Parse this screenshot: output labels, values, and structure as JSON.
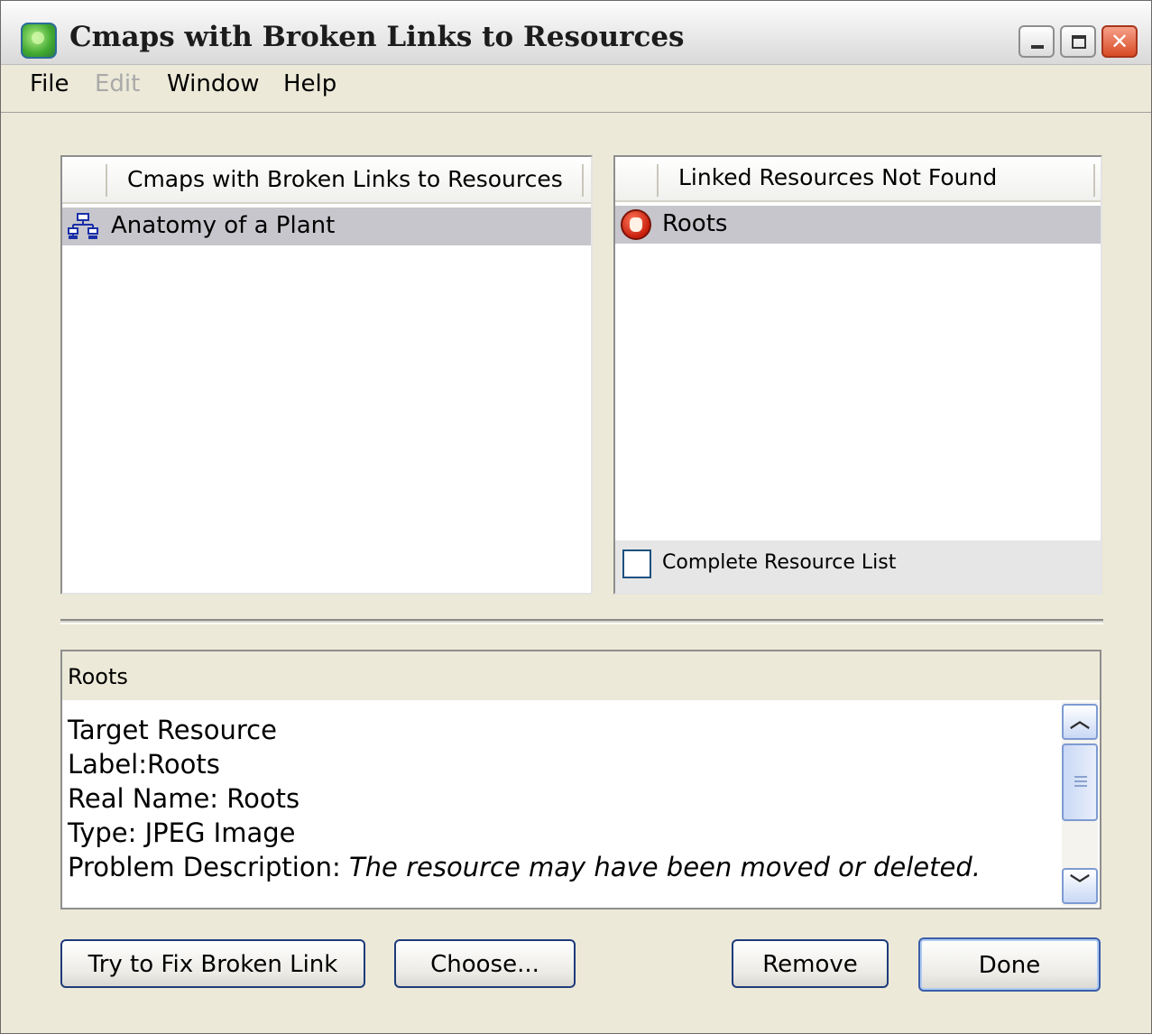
{
  "window": {
    "title": "Cmaps with Broken Links to Resources"
  },
  "menu": {
    "items": [
      {
        "label": "File",
        "enabled": true
      },
      {
        "label": "Edit",
        "enabled": false
      },
      {
        "label": "Window",
        "enabled": true
      },
      {
        "label": "Help",
        "enabled": true
      }
    ]
  },
  "cmaps_list": {
    "header": "Cmaps with Broken Links to Resources",
    "rows": [
      {
        "label": "Anatomy of a Plant",
        "icon": "cmap-icon",
        "selected": true
      }
    ]
  },
  "resources_list": {
    "header": "Linked Resources Not Found",
    "rows": [
      {
        "label": "Roots",
        "icon": "stop-icon",
        "selected": true
      }
    ],
    "complete_list_checkbox": {
      "label": "Complete Resource List",
      "checked": false
    }
  },
  "details": {
    "title": "Roots",
    "lines": [
      {
        "text": "Target Resource"
      },
      {
        "text": "Label:Roots"
      },
      {
        "text": "Real Name: Roots"
      },
      {
        "text": "Type: JPEG Image"
      },
      {
        "label": "Problem Description: ",
        "value": "The resource may have been moved or deleted."
      }
    ]
  },
  "buttons": {
    "fix": "Try to Fix Broken Link",
    "choose": "Choose...",
    "remove": "Remove",
    "done": "Done"
  },
  "colors": {
    "selection": "#c6c6cc",
    "window_bg": "#ece9d8",
    "button_border": "#1d3b7a"
  }
}
